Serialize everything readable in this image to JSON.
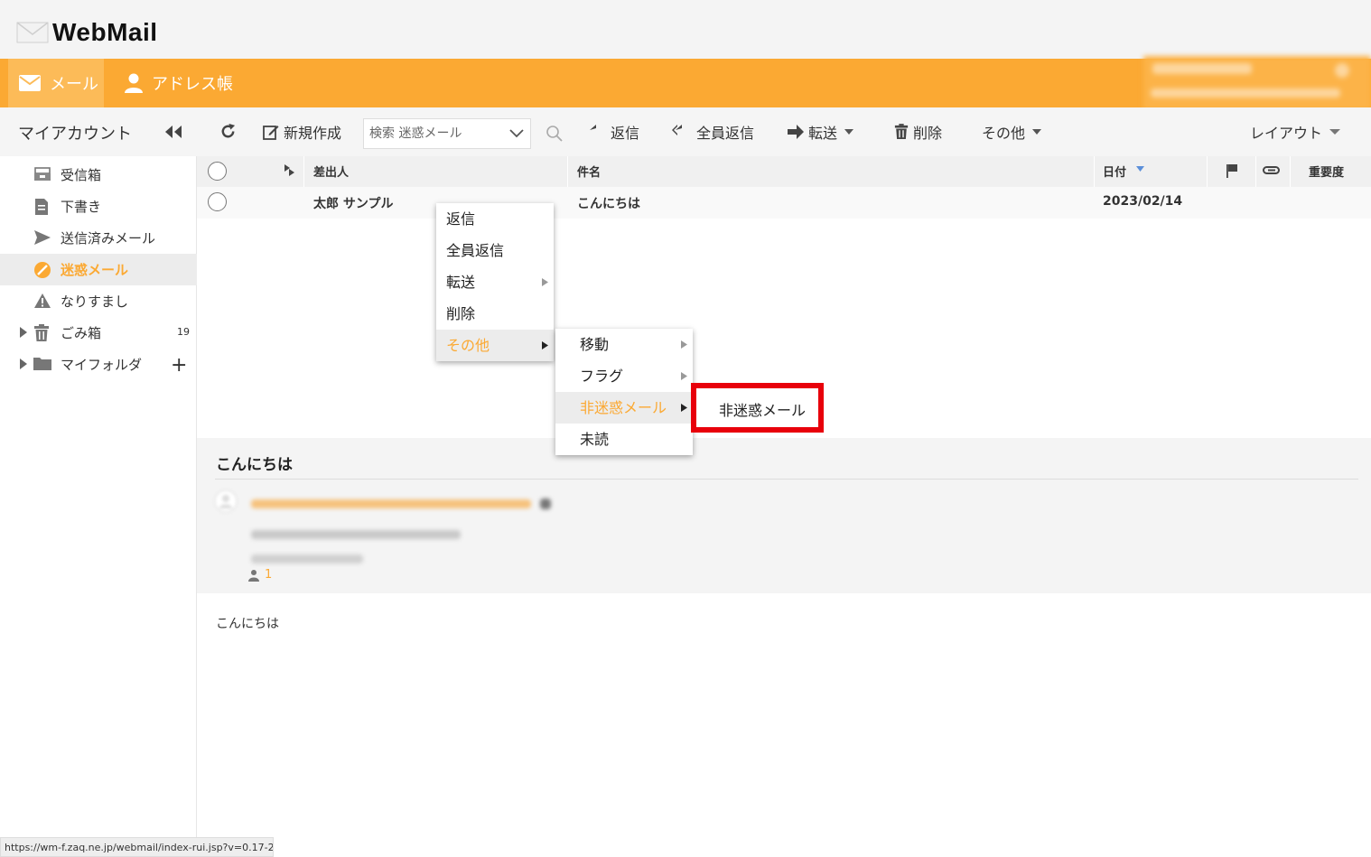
{
  "app": {
    "logo_text": "WebMail"
  },
  "nav": {
    "mail_label": "メール",
    "address_label": "アドレス帳"
  },
  "sidebar": {
    "title": "マイアカウント",
    "folders": [
      {
        "label": "受信箱",
        "icon": "inbox-icon"
      },
      {
        "label": "下書き",
        "icon": "draft-icon"
      },
      {
        "label": "送信済みメール",
        "icon": "send-icon"
      },
      {
        "label": "迷惑メール",
        "icon": "spam-icon"
      },
      {
        "label": "なりすまし",
        "icon": "warning-icon"
      },
      {
        "label": "ごみ箱",
        "icon": "trash-icon",
        "count": "19"
      },
      {
        "label": "マイフォルダ",
        "icon": "folder-icon"
      }
    ]
  },
  "toolbar": {
    "new_label": "新規作成",
    "search_placeholder": "検索 迷惑メール",
    "reply_label": "返信",
    "reply_all_label": "全員返信",
    "forward_label": "転送",
    "delete_label": "削除",
    "more_label": "その他",
    "layout_label": "レイアウト"
  },
  "list": {
    "columns": {
      "from": "差出人",
      "subject": "件名",
      "date": "日付",
      "importance": "重要度"
    },
    "rows": [
      {
        "from": "太郎 サンプル",
        "subject": "こんにちは",
        "date": "2023/02/14"
      }
    ]
  },
  "context_menu": {
    "items": [
      "返信",
      "全員返信",
      "転送",
      "削除",
      "その他"
    ],
    "active": "その他"
  },
  "submenu": {
    "items": [
      "移動",
      "フラグ",
      "非迷惑メール",
      "未読"
    ],
    "active": "非迷惑メール"
  },
  "submenu2": {
    "items": [
      "非迷惑メール"
    ]
  },
  "preview": {
    "subject": "こんにちは",
    "recipient_count": "1",
    "body": "こんにちは"
  },
  "statusbar": {
    "url": "https://wm-f.zaq.ne.jp/webmail/index-rui.jsp?v=0.17-2#"
  },
  "colors": {
    "accent": "#fba933",
    "highlight_border": "#e8000b"
  }
}
